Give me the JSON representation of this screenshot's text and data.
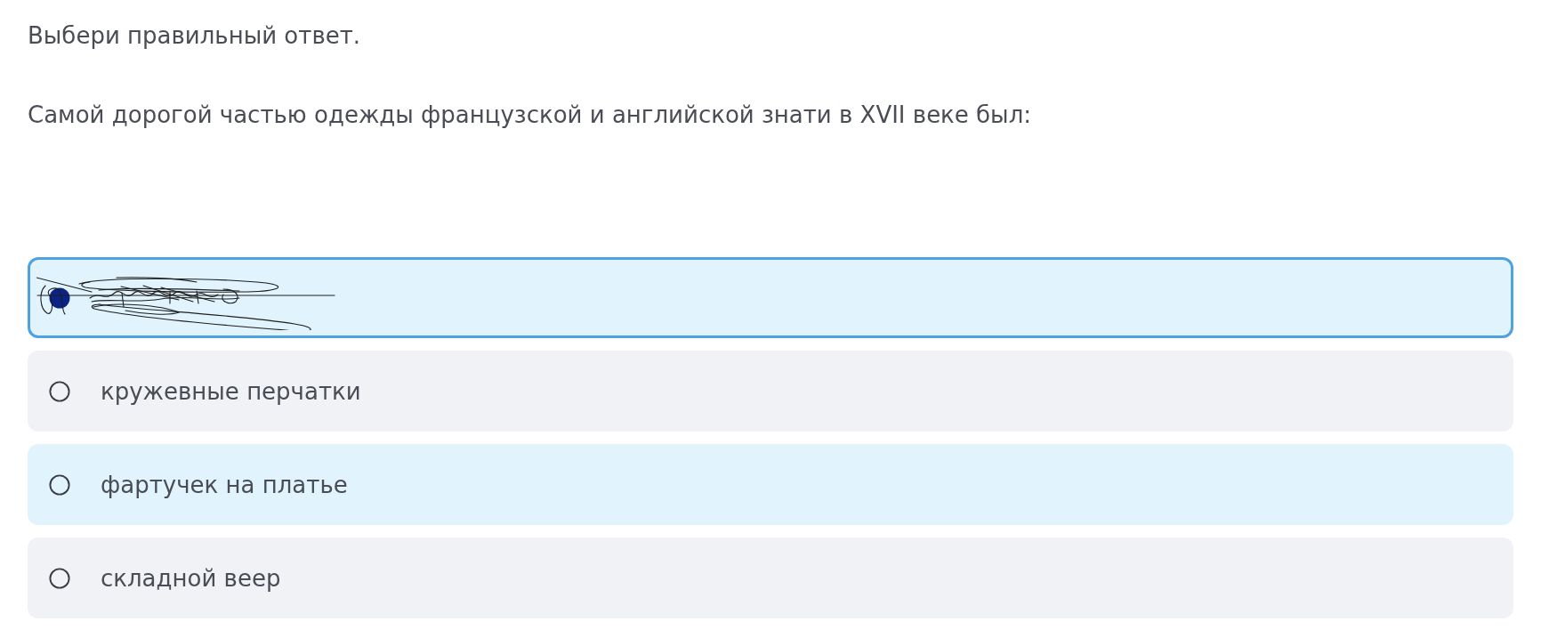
{
  "instruction": "Выбери правильный ответ.",
  "question": "Самой дорогой частью одежды французской и английской знати в XVII веке был:",
  "options": [
    {
      "selected": true,
      "hovered": false,
      "scribbled_over": true
    },
    {
      "label": "кружевные перчатки",
      "selected": false,
      "hovered": false,
      "scribbled_over": false
    },
    {
      "label": "фартучек на платье",
      "selected": false,
      "hovered": true,
      "scribbled_over": false
    },
    {
      "label": "складной веер",
      "selected": false,
      "hovered": false,
      "scribbled_over": false
    }
  ]
}
